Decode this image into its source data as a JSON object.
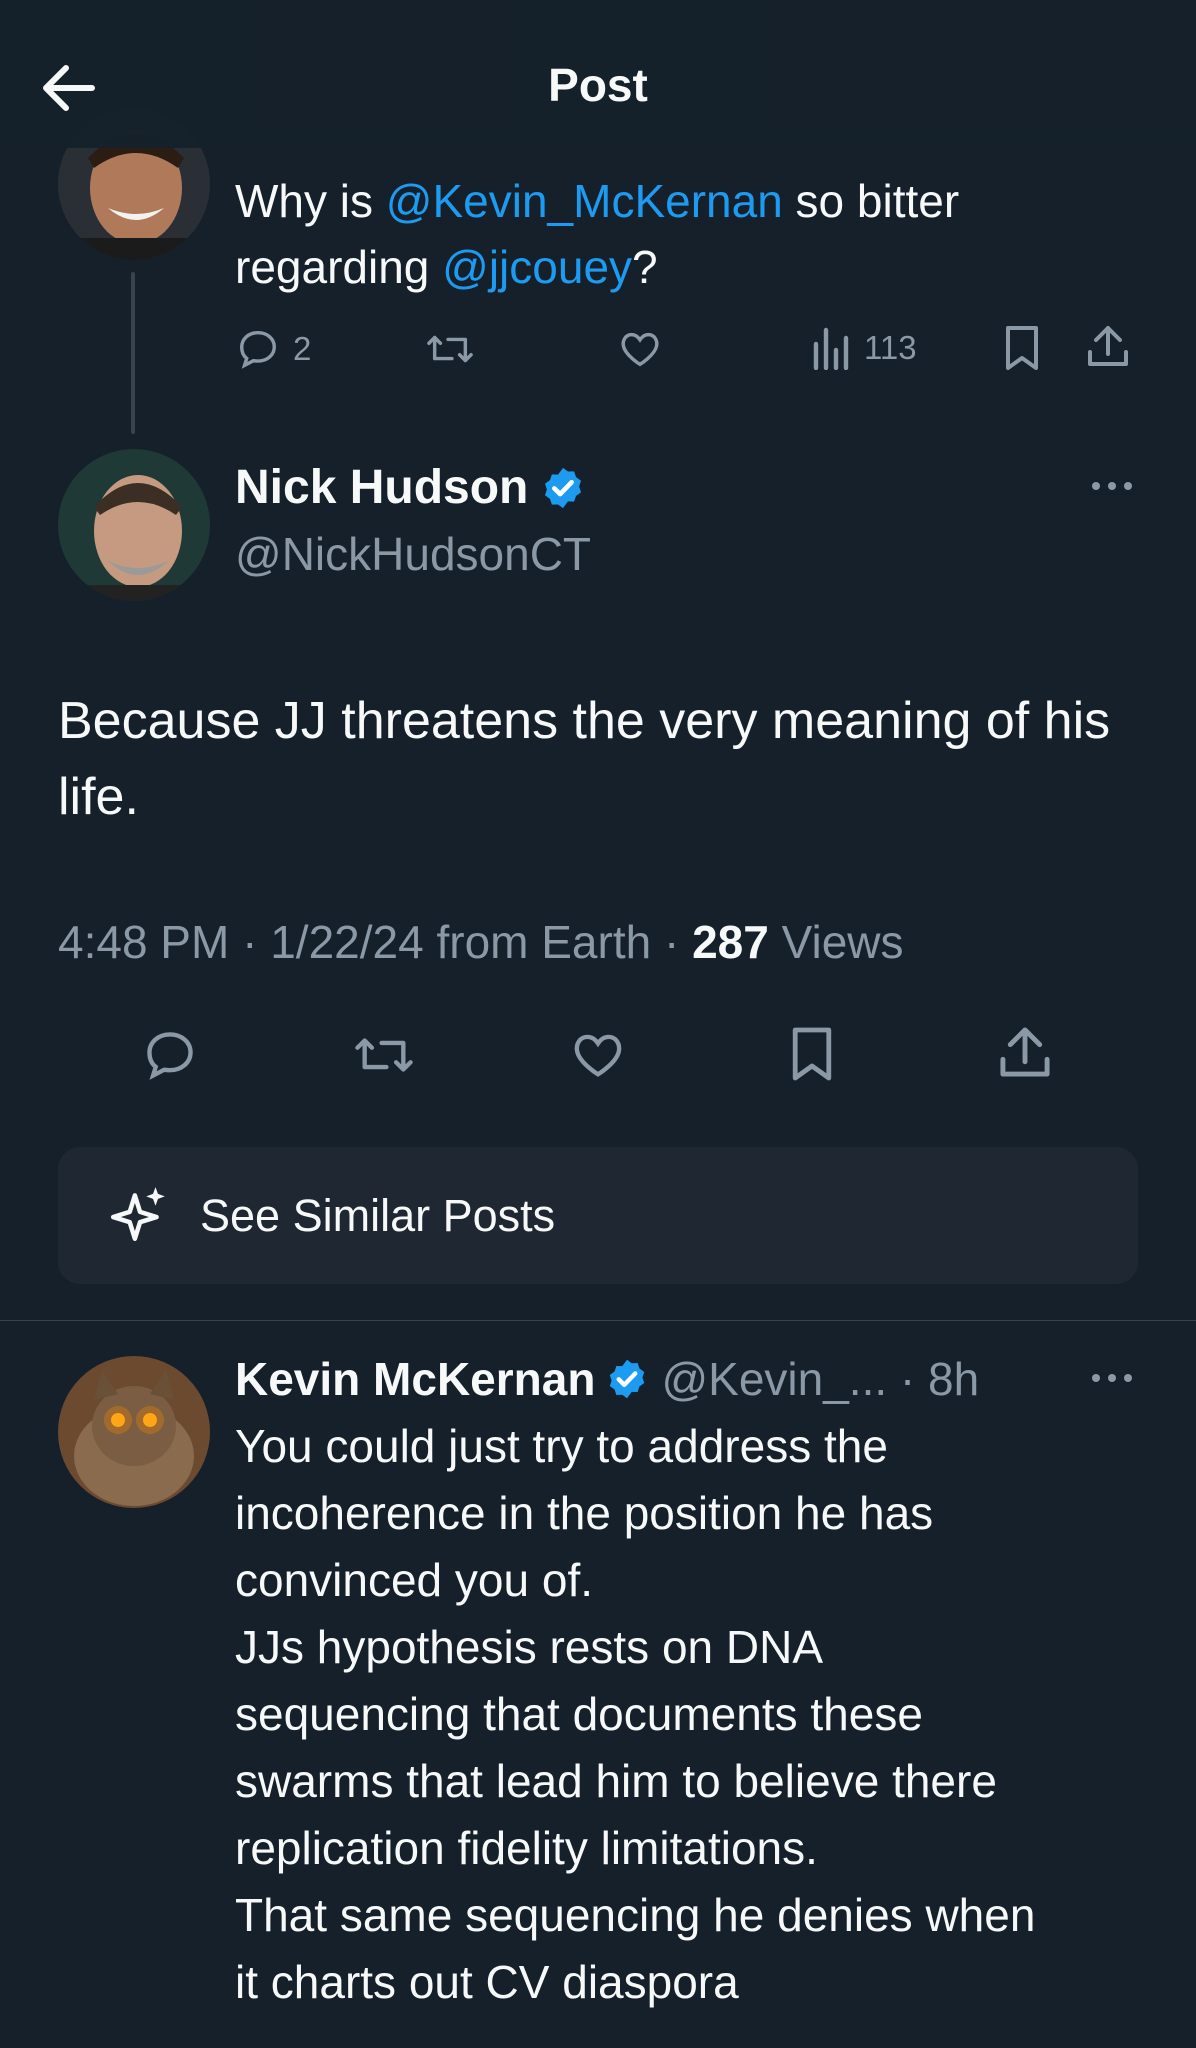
{
  "header": {
    "title": "Post"
  },
  "parent_post": {
    "text_prefix": "Why is ",
    "mention_1": "@Kevin_McKernan",
    "text_middle": " so bitter regarding ",
    "mention_2": "@jjcouey",
    "text_suffix": "?",
    "reply_count": "2",
    "view_count": "113"
  },
  "main_post": {
    "author_name": "Nick Hudson",
    "author_handle": "@NickHudsonCT",
    "text": "Because JJ threatens the very meaning of his life.",
    "time": "4:48 PM",
    "date": "1/22/24",
    "source": "from Earth",
    "views_count": "287",
    "views_label": "Views"
  },
  "similar_posts": {
    "label": "See Similar Posts"
  },
  "reply": {
    "author_name": "Kevin McKernan",
    "author_handle": "@Kevin_...",
    "age": "8h",
    "text_lines": [
      "You could just try to address the",
      "incoherence in the position he has",
      "convinced you of.",
      "JJs hypothesis rests on DNA",
      "sequencing that documents these",
      "swarms that lead him to believe there",
      "replication fidelity limitations.",
      "That same sequencing he denies when",
      "it charts out CV diaspora"
    ]
  },
  "colors": {
    "background": "#15202b",
    "accent": "#1d9bf0",
    "muted": "#8b98a5",
    "verified": "#1d9bf0"
  },
  "icons": [
    "back-arrow-icon",
    "reply-icon",
    "retweet-icon",
    "like-icon",
    "views-icon",
    "bookmark-icon",
    "share-icon",
    "more-icon",
    "verified-icon",
    "sparkle-icon"
  ]
}
